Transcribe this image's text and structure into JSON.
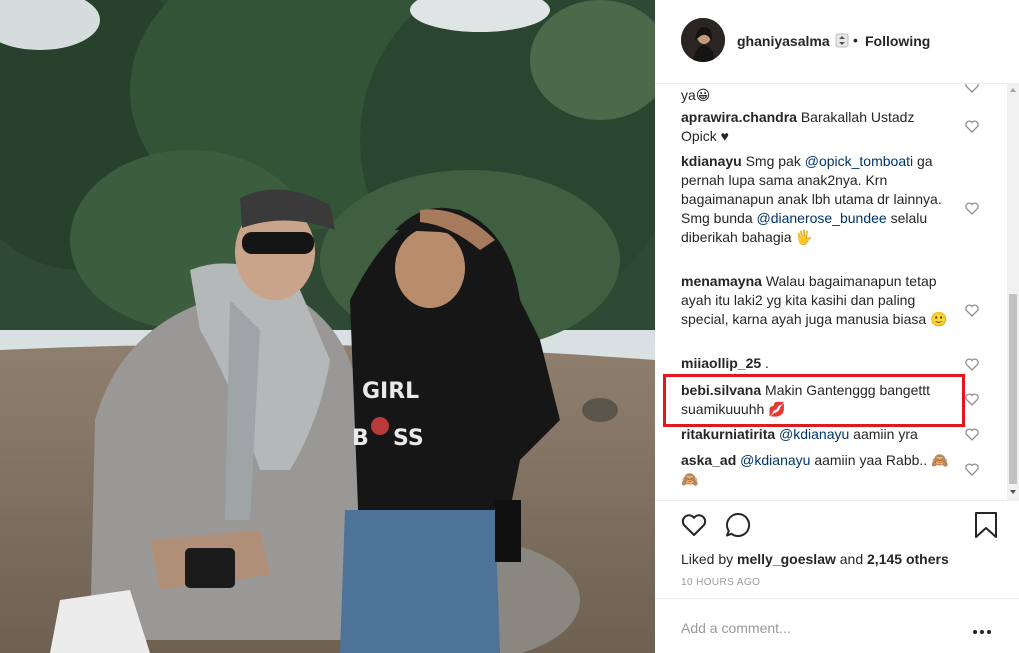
{
  "header": {
    "username": "ghaniyasalma",
    "separator": "•",
    "follow_state": "Following"
  },
  "comments": [
    {
      "user": "",
      "parts": [
        {
          "t": "ya😀"
        }
      ]
    },
    {
      "user": "aprawira.chandra",
      "parts": [
        {
          "t": "Barakallah Ustadz Opick ♥"
        }
      ]
    },
    {
      "user": "kdianayu",
      "parts": [
        {
          "t": "Smg pak "
        },
        {
          "m": "@opick_tomboati"
        },
        {
          "t": " ga pernah lupa sama anak2nya. Krn bagaimanapun anak lbh utama dr lainnya. Smg bunda "
        },
        {
          "m": "@dianerose_bundee"
        },
        {
          "t": " selalu diberikah bahagia 🖐"
        }
      ]
    },
    {
      "user": "menamayna",
      "parts": [
        {
          "t": "Walau bagaimanapun tetap ayah itu laki2 yg kita kasihi dan paling special, karna ayah juga manusia biasa 🙂"
        }
      ]
    },
    {
      "user": "miiaollip_25",
      "parts": [
        {
          "t": "."
        }
      ]
    },
    {
      "user": "bebi.silvana",
      "parts": [
        {
          "t": "Makin Gantenggg bangettt suamikuuuhh 💋"
        }
      ]
    },
    {
      "user": "ritakurniatirita",
      "parts": [
        {
          "m": "@kdianayu"
        },
        {
          "t": " aamiin yra"
        }
      ]
    },
    {
      "user": "aska_ad",
      "parts": [
        {
          "m": "@kdianayu"
        },
        {
          "t": " aamiin yaa Rabb.. 🙈🙈"
        }
      ]
    }
  ],
  "likes": {
    "prefix": "Liked by ",
    "user": "melly_goeslaw",
    "middle": " and ",
    "count": "2,145 others"
  },
  "timestamp": "10 HOURS AGO",
  "add_comment": {
    "placeholder": "Add a comment..."
  },
  "icons": {
    "like": "heart-outline-icon",
    "comment": "speech-bubble-icon",
    "save": "bookmark-icon",
    "more": "ellipsis-icon",
    "verified": "verified-badge-icon"
  },
  "colors": {
    "text": "#262626",
    "mention": "#003569",
    "muted": "#999999",
    "highlight": "#e0191e"
  }
}
